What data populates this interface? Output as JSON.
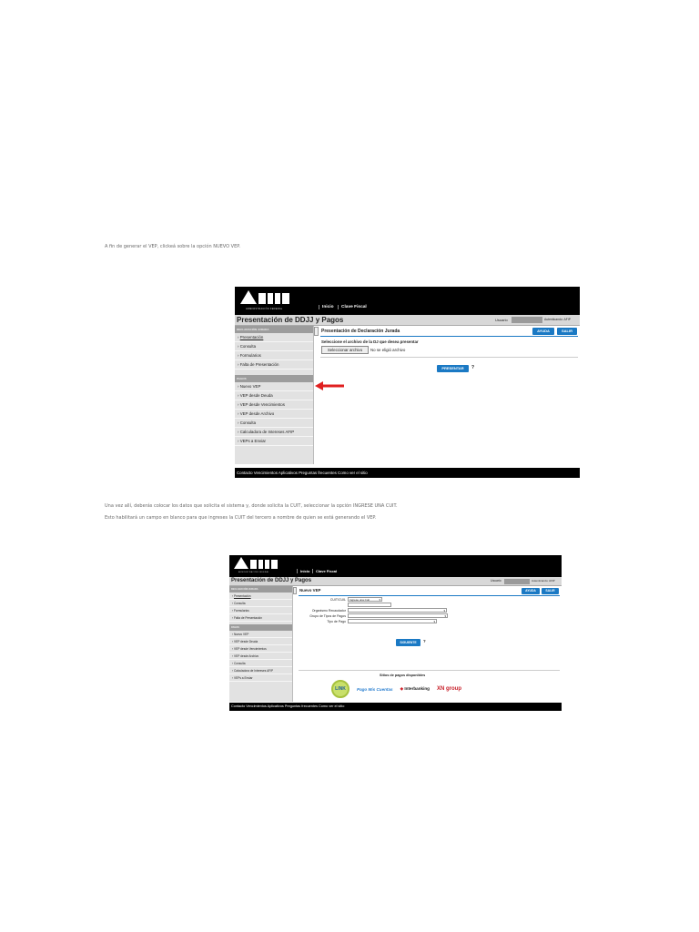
{
  "paragraphs": {
    "p1": "A fin de generar el VEP, clickeá sobre la opción NUEVO VEP.",
    "p2": "Una vez allí, deberás colocar los datos que solicita el sistema y, donde solicita la CUIT, seleccionar la opción INGRESE UNA CUIT.",
    "p3": "Esto habilitará un campo en blanco para que ingreses la CUIT del tercero a nombre de quien se está generando el VEP."
  },
  "shot1": {
    "logo_sub": "ADMINISTRACIÓN FEDERAL",
    "nav": [
      "Inicio",
      "Clave Fiscal"
    ],
    "title": "Presentación de DDJJ y Pagos",
    "user_label": "Usuario",
    "represent_label": "Autenticando: AFIP",
    "sidebar_head1": "DECLARACIÓN JURADA",
    "sidebar_items1": [
      "Presentación",
      "Consulta",
      "Formularios",
      "Falta de Presentación"
    ],
    "sidebar_head2": "PAGOS",
    "sidebar_items2": [
      "Nuevo VEP",
      "VEP desde Deuda",
      "VEP desde Vencimientos",
      "VEP desde Archivo",
      "Consulta",
      "Calculadora de Intereses AFIP",
      "VEPs a Enviar"
    ],
    "panel_title": "Presentación de Declaración Jurada",
    "btn_ayuda": "AYUDA",
    "btn_salir": "SALIR",
    "instruction": "Seleccione el archivo de la DJ que desea presentar",
    "file_button": "Seleccionar archivo",
    "file_none": "No se eligió archivo",
    "btn_presentar": "PRESENTAR",
    "help_mark": "?",
    "footer": "Contacto   Vencimientos   Aplicativos   Preguntas frecuentes   Como ver el sitio"
  },
  "shot2": {
    "logo_sub": "ADMINISTRACIÓN FEDERAL",
    "nav": [
      "Inicio",
      "Clave Fiscal"
    ],
    "title": "Presentación de DDJJ y Pagos",
    "user_label": "Usuario",
    "represent_label": "Autenticando: AFIP",
    "sidebar_head1": "DECLARACIÓN JURADA",
    "sidebar_items1": [
      "Presentación",
      "Consulta",
      "Formularios",
      "Falta de Presentación"
    ],
    "sidebar_head2": "PAGOS",
    "sidebar_items2": [
      "Nuevo VEP",
      "VEP desde Deuda",
      "VEP desde Vencimientos",
      "VEP desde Archivo",
      "Consulta",
      "Calculadora de Intereses AFIP",
      "VEPs a Enviar"
    ],
    "panel_title": "Nuevo VEP",
    "btn_ayuda": "AYUDA",
    "btn_salir": "SALIR",
    "cuit_label": "CUIT/CUIL",
    "cuit_value": "Ingrese una Cuit",
    "org_label": "Organismo Recaudador",
    "grupo_label": "Grupo de Tipos de Pagos",
    "tipo_label": "Tipo de Pago",
    "btn_siguiente": "SIGUIENTE",
    "help_mark": "?",
    "sites_title": "Sitios de pagos disponibles",
    "pay_sites": [
      "LINK",
      "Pago Mis Cuentas",
      "Interbanking",
      "XN group"
    ],
    "footer": "Contacto   Vencimientos   Aplicativos   Preguntas frecuentes   Como ver el sitio"
  },
  "colors": {
    "accent_blue": "#1a79c4",
    "arrow_red": "#e02020"
  }
}
